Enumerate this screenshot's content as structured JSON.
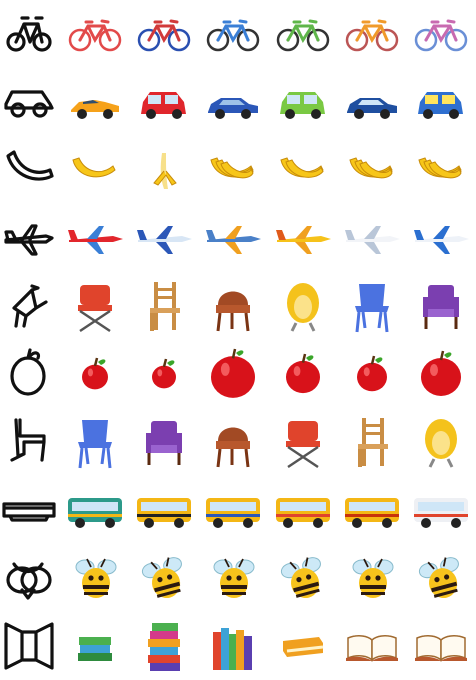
{
  "rows": [
    {
      "sketch_icon": "bicycle-sketch-icon",
      "category": "bicycle",
      "items": [
        "red-bicycle-icon",
        "blue-red-bicycle-icon",
        "blue-bicycle-icon",
        "green-bicycle-icon",
        "orange-bicycle-icon",
        "pink-bicycle-icon"
      ]
    },
    {
      "sketch_icon": "car-sketch-icon",
      "category": "car",
      "items": [
        "orange-sports-car-icon",
        "red-car-icon",
        "blue-sedan-icon",
        "green-hatchback-icon",
        "blue-car-icon",
        "cartoon-car-icon"
      ]
    },
    {
      "sketch_icon": "banana-sketch-icon",
      "category": "banana",
      "items": [
        "single-banana-icon",
        "peeled-banana-icon",
        "banana-bunch-icon",
        "banana-pair-icon",
        "banana-bunch-icon",
        "banana-bunch-icon"
      ]
    },
    {
      "sketch_icon": "airplane-sketch-icon",
      "category": "airplane",
      "items": [
        "red-propeller-plane-icon",
        "blue-jet-icon",
        "cartoon-plane-icon",
        "yellow-plane-icon",
        "white-airliner-icon",
        "blue-airliner-icon"
      ]
    },
    {
      "sketch_icon": "chair-sketch-icon",
      "category": "chair",
      "items": [
        "red-folding-chair-icon",
        "wooden-chair-icon",
        "wicker-chair-icon",
        "yellow-egg-chair-icon",
        "blue-plastic-chair-icon",
        "purple-armchair-icon"
      ]
    },
    {
      "sketch_icon": "apple-sketch-icon",
      "category": "apple",
      "items": [
        "small-apple-icon",
        "red-apple-icon",
        "big-apple-icon",
        "red-apple-icon",
        "round-apple-icon",
        "big-apple-icon"
      ]
    },
    {
      "sketch_icon": "chair-sketch-icon",
      "category": "chair",
      "items": [
        "blue-plastic-chair-icon",
        "purple-armchair-icon",
        "wicker-chair-icon",
        "red-folding-chair-icon",
        "wooden-chair-icon",
        "yellow-egg-chair-icon"
      ]
    },
    {
      "sketch_icon": "bus-sketch-icon",
      "category": "bus",
      "items": [
        "green-bus-icon",
        "yellow-school-bus-icon",
        "yellow-bus-icon",
        "yellow-bus-icon",
        "yellow-bus-icon",
        "white-coach-bus-icon"
      ]
    },
    {
      "sketch_icon": "bee-sketch-icon",
      "category": "bee",
      "items": [
        "bee-icon",
        "flying-bee-icon",
        "bee-icon",
        "flying-bee-icon",
        "bee-icon",
        "flying-bee-icon"
      ]
    },
    {
      "sketch_icon": "book-sketch-icon",
      "category": "book",
      "items": [
        "book-stack-icon",
        "tall-book-stack-icon",
        "books-upright-icon",
        "closed-book-icon",
        "open-book-icon",
        "open-book-icon"
      ]
    }
  ],
  "colors": {
    "sketch_stroke": "#111111",
    "banana_yellow": "#f7c619",
    "apple_red": "#d8121a",
    "bus_yellow": "#f4b715",
    "bee_yellow": "#f7c31c",
    "chair_red": "#e0442c",
    "chair_blue": "#4b72e0",
    "chair_purple": "#7b3fb0"
  }
}
